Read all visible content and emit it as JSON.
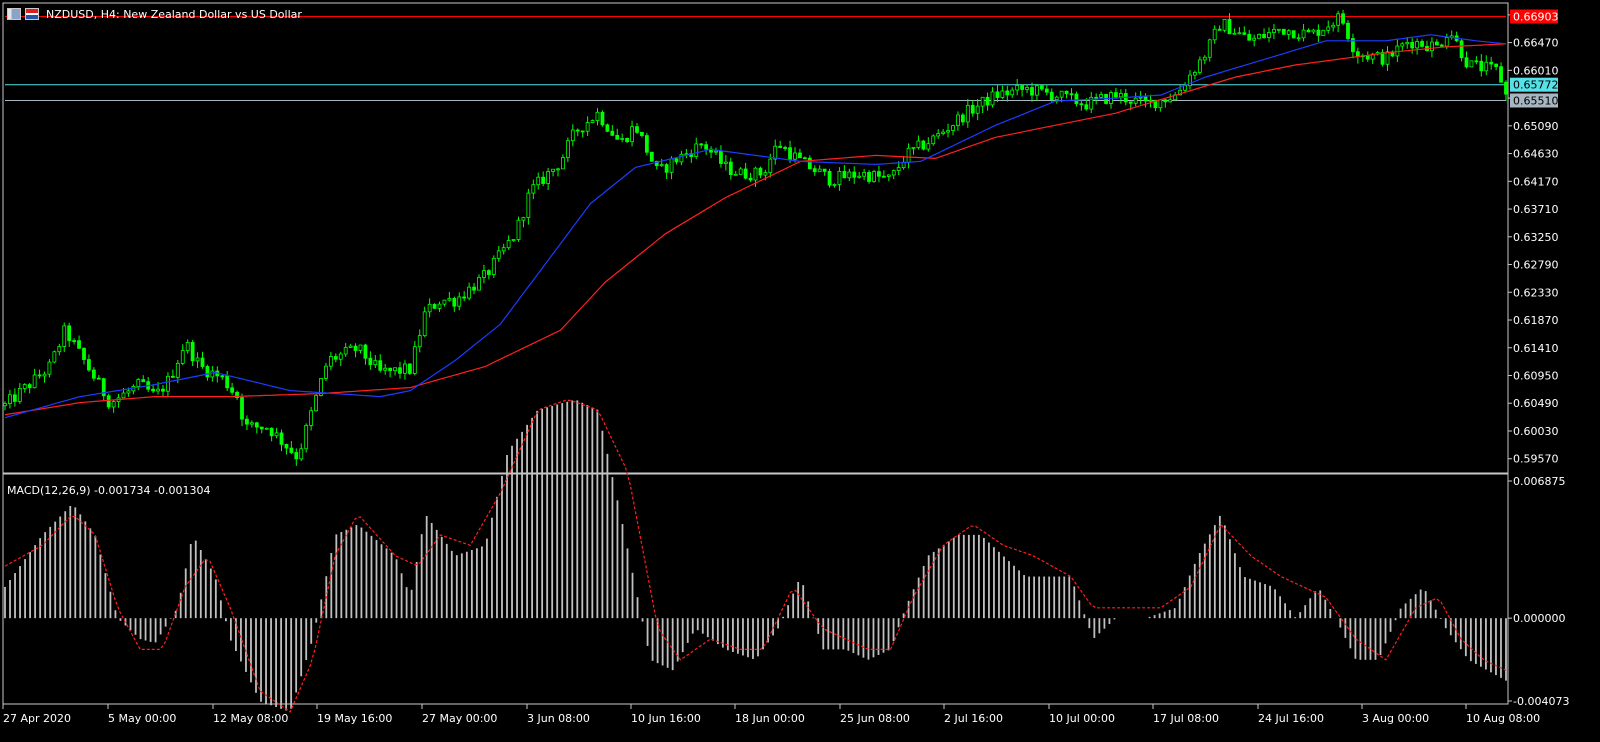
{
  "title_bar": {
    "text": "NZDUSD, H4:  New Zealand Dollar vs US Dollar",
    "icons": [
      "chart-type-icon",
      "nz-us-flag-icon"
    ]
  },
  "macd_header": {
    "text": "MACD(12,26,9) -0.001734 -0.001304"
  },
  "colors": {
    "background": "#000000",
    "frame": "#c8c8c8",
    "candle": "#00ff00",
    "ma_fast": "#1e3cff",
    "ma_slow": "#ff2020",
    "macd_hist": "#c0c0c0",
    "macd_signal": "#ff2020",
    "line_red": "#ff0000",
    "line_cyan": "#57e0e6",
    "line_gray": "#a8b6c2"
  },
  "chart_data": [
    {
      "type": "candlestick",
      "symbol": "NZDUSD",
      "timeframe": "H4",
      "y_ticks": [
        "0.66930",
        "0.66470",
        "0.66010",
        "0.65550",
        "0.65090",
        "0.64630",
        "0.64170",
        "0.63710",
        "0.63250",
        "0.62790",
        "0.62330",
        "0.61870",
        "0.61410",
        "0.60950",
        "0.60490",
        "0.60030",
        "0.59570"
      ],
      "ylim": [
        0.5935,
        0.6711
      ],
      "x_ticks": [
        "27 Apr 2020",
        "5 May 00:00",
        "12 May 08:00",
        "19 May 16:00",
        "27 May 00:00",
        "3 Jun 08:00",
        "10 Jun 16:00",
        "18 Jun 00:00",
        "25 Jun 08:00",
        "2 Jul 16:00",
        "10 Jul 00:00",
        "17 Jul 08:00",
        "24 Jul 16:00",
        "3 Aug 00:00",
        "10 Aug 08:00"
      ],
      "close_path": [
        [
          0,
          0.6045
        ],
        [
          0.03,
          0.611
        ],
        [
          0.04,
          0.617
        ],
        [
          0.055,
          0.611
        ],
        [
          0.07,
          0.605
        ],
        [
          0.09,
          0.608
        ],
        [
          0.1,
          0.606
        ],
        [
          0.11,
          0.609
        ],
        [
          0.12,
          0.615
        ],
        [
          0.13,
          0.611
        ],
        [
          0.145,
          0.609
        ],
        [
          0.155,
          0.606
        ],
        [
          0.16,
          0.601
        ],
        [
          0.175,
          0.601
        ],
        [
          0.195,
          0.596
        ],
        [
          0.205,
          0.604
        ],
        [
          0.215,
          0.612
        ],
        [
          0.235,
          0.614
        ],
        [
          0.25,
          0.61
        ],
        [
          0.27,
          0.6105
        ],
        [
          0.28,
          0.62
        ],
        [
          0.29,
          0.622
        ],
        [
          0.3,
          0.622
        ],
        [
          0.32,
          0.626
        ],
        [
          0.34,
          0.633
        ],
        [
          0.35,
          0.64
        ],
        [
          0.37,
          0.645
        ],
        [
          0.38,
          0.65
        ],
        [
          0.395,
          0.653
        ],
        [
          0.41,
          0.648
        ],
        [
          0.42,
          0.651
        ],
        [
          0.435,
          0.643
        ],
        [
          0.445,
          0.645
        ],
        [
          0.465,
          0.648
        ],
        [
          0.48,
          0.644
        ],
        [
          0.49,
          0.643
        ],
        [
          0.505,
          0.643
        ],
        [
          0.515,
          0.648
        ],
        [
          0.53,
          0.645
        ],
        [
          0.55,
          0.642
        ],
        [
          0.57,
          0.643
        ],
        [
          0.59,
          0.642
        ],
        [
          0.6,
          0.646
        ],
        [
          0.62,
          0.649
        ],
        [
          0.64,
          0.653
        ],
        [
          0.66,
          0.656
        ],
        [
          0.68,
          0.657
        ],
        [
          0.7,
          0.656
        ],
        [
          0.72,
          0.6545
        ],
        [
          0.74,
          0.656
        ],
        [
          0.76,
          0.6545
        ],
        [
          0.78,
          0.656
        ],
        [
          0.8,
          0.663
        ],
        [
          0.81,
          0.668
        ],
        [
          0.83,
          0.665
        ],
        [
          0.85,
          0.667
        ],
        [
          0.87,
          0.666
        ],
        [
          0.89,
          0.669
        ],
        [
          0.9,
          0.663
        ],
        [
          0.92,
          0.662
        ],
        [
          0.935,
          0.665
        ],
        [
          0.955,
          0.664
        ],
        [
          0.962,
          0.667
        ],
        [
          0.975,
          0.661
        ],
        [
          0.995,
          0.66
        ],
        [
          1.0,
          0.656
        ]
      ],
      "ma_fast_path": [
        [
          0,
          0.6025
        ],
        [
          0.05,
          0.606
        ],
        [
          0.1,
          0.608
        ],
        [
          0.14,
          0.61
        ],
        [
          0.19,
          0.607
        ],
        [
          0.25,
          0.606
        ],
        [
          0.27,
          0.607
        ],
        [
          0.3,
          0.612
        ],
        [
          0.33,
          0.618
        ],
        [
          0.36,
          0.628
        ],
        [
          0.39,
          0.638
        ],
        [
          0.42,
          0.644
        ],
        [
          0.47,
          0.647
        ],
        [
          0.53,
          0.645
        ],
        [
          0.58,
          0.6445
        ],
        [
          0.61,
          0.645
        ],
        [
          0.66,
          0.651
        ],
        [
          0.7,
          0.655
        ],
        [
          0.74,
          0.6555
        ],
        [
          0.77,
          0.656
        ],
        [
          0.8,
          0.659
        ],
        [
          0.84,
          0.662
        ],
        [
          0.88,
          0.665
        ],
        [
          0.92,
          0.665
        ],
        [
          0.95,
          0.666
        ],
        [
          0.98,
          0.665
        ],
        [
          1.0,
          0.6645
        ]
      ],
      "ma_slow_path": [
        [
          0,
          0.603
        ],
        [
          0.05,
          0.605
        ],
        [
          0.1,
          0.606
        ],
        [
          0.15,
          0.606
        ],
        [
          0.21,
          0.6065
        ],
        [
          0.27,
          0.6075
        ],
        [
          0.32,
          0.611
        ],
        [
          0.37,
          0.617
        ],
        [
          0.4,
          0.625
        ],
        [
          0.44,
          0.633
        ],
        [
          0.48,
          0.639
        ],
        [
          0.53,
          0.645
        ],
        [
          0.58,
          0.646
        ],
        [
          0.62,
          0.6455
        ],
        [
          0.66,
          0.649
        ],
        [
          0.7,
          0.651
        ],
        [
          0.74,
          0.653
        ],
        [
          0.78,
          0.656
        ],
        [
          0.82,
          0.659
        ],
        [
          0.86,
          0.661
        ],
        [
          0.89,
          0.662
        ],
        [
          0.92,
          0.663
        ],
        [
          0.96,
          0.664
        ],
        [
          1.0,
          0.6645
        ]
      ],
      "lines": [
        {
          "label": "0.66903",
          "value": 0.66903,
          "color": "#ff0000",
          "text_color": "#ffffff"
        },
        {
          "label": "0.65772",
          "value": 0.65772,
          "color": "#57e0e6",
          "text_color": "#000000"
        },
        {
          "label": "0.65510",
          "value": 0.6551,
          "color": "#a8b6c2",
          "text_color": "#000000"
        }
      ]
    },
    {
      "type": "bar",
      "name": "MACD(12,26,9)",
      "y_ticks": [
        "0.006875",
        "0.000000",
        "-0.004073"
      ],
      "ylim": [
        -0.004073,
        0.006875
      ],
      "hist_path": [
        [
          0,
          0.0015
        ],
        [
          0.025,
          0.004
        ],
        [
          0.045,
          0.0055
        ],
        [
          0.06,
          0.004
        ],
        [
          0.075,
          0.0
        ],
        [
          0.09,
          -0.001
        ],
        [
          0.1,
          -0.0012
        ],
        [
          0.115,
          0.0005
        ],
        [
          0.125,
          0.004
        ],
        [
          0.14,
          0.002
        ],
        [
          0.15,
          -0.001
        ],
        [
          0.17,
          -0.004
        ],
        [
          0.19,
          -0.0045
        ],
        [
          0.205,
          -0.001
        ],
        [
          0.22,
          0.004
        ],
        [
          0.235,
          0.0045
        ],
        [
          0.26,
          0.003
        ],
        [
          0.27,
          0.001
        ],
        [
          0.28,
          0.005
        ],
        [
          0.3,
          0.003
        ],
        [
          0.32,
          0.0035
        ],
        [
          0.335,
          0.008
        ],
        [
          0.355,
          0.01
        ],
        [
          0.38,
          0.0105
        ],
        [
          0.395,
          0.01
        ],
        [
          0.41,
          0.005
        ],
        [
          0.43,
          -0.002
        ],
        [
          0.445,
          -0.0025
        ],
        [
          0.46,
          -0.0005
        ],
        [
          0.48,
          -0.0015
        ],
        [
          0.5,
          -0.002
        ],
        [
          0.515,
          -0.0005
        ],
        [
          0.53,
          0.002
        ],
        [
          0.545,
          -0.0015
        ],
        [
          0.56,
          -0.0015
        ],
        [
          0.575,
          -0.002
        ],
        [
          0.59,
          -0.0015
        ],
        [
          0.6,
          0.0005
        ],
        [
          0.615,
          0.003
        ],
        [
          0.635,
          0.004
        ],
        [
          0.65,
          0.004
        ],
        [
          0.665,
          0.003
        ],
        [
          0.68,
          0.002
        ],
        [
          0.71,
          0.002
        ],
        [
          0.725,
          -0.001
        ],
        [
          0.74,
          0.0
        ],
        [
          0.76,
          0.0
        ],
        [
          0.78,
          0.0005
        ],
        [
          0.795,
          0.003
        ],
        [
          0.81,
          0.005
        ],
        [
          0.825,
          0.002
        ],
        [
          0.845,
          0.0015
        ],
        [
          0.86,
          0.0
        ],
        [
          0.875,
          0.0015
        ],
        [
          0.89,
          -0.0005
        ],
        [
          0.9,
          -0.002
        ],
        [
          0.915,
          -0.002
        ],
        [
          0.93,
          0.0005
        ],
        [
          0.945,
          0.0015
        ],
        [
          0.96,
          -0.0005
        ],
        [
          0.975,
          -0.002
        ],
        [
          1.0,
          -0.003
        ]
      ],
      "signal_path": [
        [
          0,
          0.0025
        ],
        [
          0.025,
          0.0035
        ],
        [
          0.045,
          0.005
        ],
        [
          0.06,
          0.004
        ],
        [
          0.075,
          0.0005
        ],
        [
          0.09,
          -0.0015
        ],
        [
          0.105,
          -0.0015
        ],
        [
          0.12,
          0.0015
        ],
        [
          0.135,
          0.003
        ],
        [
          0.15,
          0.0005
        ],
        [
          0.17,
          -0.0035
        ],
        [
          0.19,
          -0.0045
        ],
        [
          0.205,
          -0.002
        ],
        [
          0.22,
          0.003
        ],
        [
          0.235,
          0.005
        ],
        [
          0.26,
          0.003
        ],
        [
          0.275,
          0.0025
        ],
        [
          0.29,
          0.004
        ],
        [
          0.31,
          0.0035
        ],
        [
          0.33,
          0.006
        ],
        [
          0.355,
          0.01
        ],
        [
          0.375,
          0.0105
        ],
        [
          0.395,
          0.01
        ],
        [
          0.415,
          0.007
        ],
        [
          0.435,
          -0.0005
        ],
        [
          0.45,
          -0.002
        ],
        [
          0.47,
          -0.001
        ],
        [
          0.49,
          -0.0015
        ],
        [
          0.505,
          -0.0015
        ],
        [
          0.525,
          0.0015
        ],
        [
          0.545,
          -0.0005
        ],
        [
          0.56,
          -0.001
        ],
        [
          0.575,
          -0.0015
        ],
        [
          0.59,
          -0.0015
        ],
        [
          0.605,
          0.001
        ],
        [
          0.625,
          0.0035
        ],
        [
          0.645,
          0.0045
        ],
        [
          0.665,
          0.0035
        ],
        [
          0.685,
          0.003
        ],
        [
          0.71,
          0.002
        ],
        [
          0.725,
          0.0005
        ],
        [
          0.745,
          0.0005
        ],
        [
          0.77,
          0.0005
        ],
        [
          0.79,
          0.0015
        ],
        [
          0.81,
          0.0045
        ],
        [
          0.83,
          0.003
        ],
        [
          0.85,
          0.002
        ],
        [
          0.865,
          0.0015
        ],
        [
          0.88,
          0.001
        ],
        [
          0.9,
          -0.001
        ],
        [
          0.92,
          -0.002
        ],
        [
          0.94,
          0.0005
        ],
        [
          0.955,
          0.001
        ],
        [
          0.97,
          -0.001
        ],
        [
          0.985,
          -0.002
        ],
        [
          1.0,
          -0.0025
        ]
      ]
    }
  ]
}
